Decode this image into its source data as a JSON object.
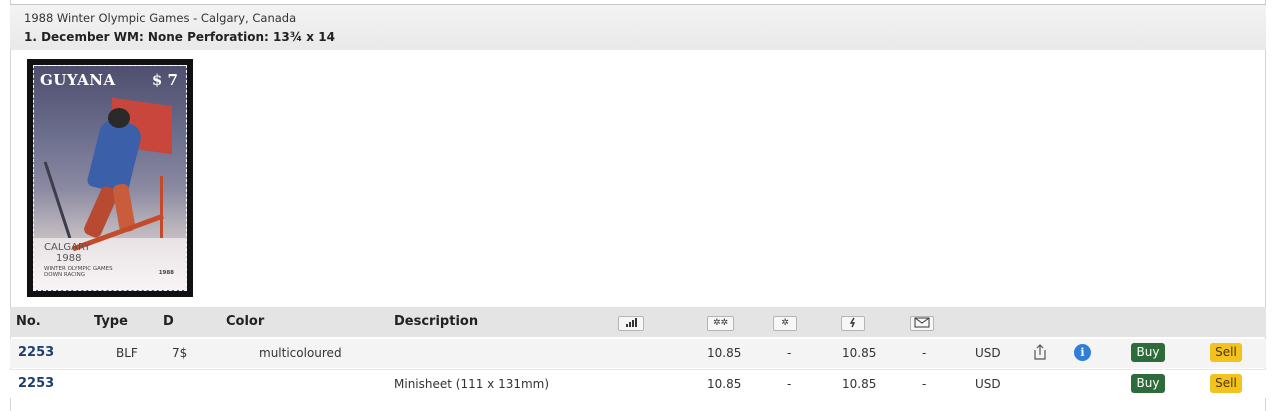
{
  "header": {
    "subtitle": "1988 Winter Olympic Games - Calgary, Canada",
    "title": "1. December WM: None Perforation: 13¾ x 14"
  },
  "stamp": {
    "country": "GUYANA",
    "value": "$ 7",
    "city": "CALGARY",
    "year": "1988",
    "event_line1": "WINTER OLYMPIC GAMES",
    "event_line2": "DOWN RACING",
    "small_year": "1988"
  },
  "table": {
    "headers": {
      "no": "No.",
      "type": "Type",
      "d": "D",
      "color": "Color",
      "description": "Description"
    },
    "header_icons": [
      "bar-chart-icon",
      "mint-never-hinged-icon",
      "mint-hinged-icon",
      "used-icon",
      "cover-envelope-icon"
    ],
    "rows": [
      {
        "no": "2253",
        "type": "BLF",
        "d": "7$",
        "color": "multicoloured",
        "description": "",
        "mnh": "10.85",
        "mh": "-",
        "used": "10.85",
        "cover": "-",
        "currency": "USD",
        "buy": "Buy",
        "sell": "Sell"
      },
      {
        "no": "2253",
        "type": "",
        "d": "",
        "color": "",
        "description": "Minisheet (111 x 131mm)",
        "mnh": "10.85",
        "mh": "-",
        "used": "10.85",
        "cover": "-",
        "currency": "USD",
        "buy": "Buy",
        "sell": "Sell"
      }
    ]
  },
  "colors": {
    "buy": "#2e6b3a",
    "sell": "#f3c21e",
    "number": "#1f3f6e",
    "info": "#2f7fd8"
  }
}
